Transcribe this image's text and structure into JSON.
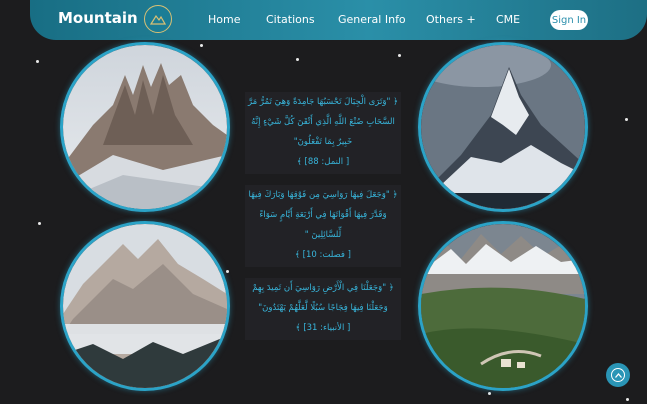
{
  "nav": {
    "brand": "Mountain",
    "links": [
      "Home",
      "Citations",
      "General Info",
      "Others +",
      "CME"
    ],
    "sign_in": "Sign In"
  },
  "verses": [
    {
      "text": "﴿ \"وَتَرَى الْجِبَالَ تَحْسَبُهَا جَامِدَةً وَهِيَ تَمُرُّ مَرَّ السَّحَابِ صُنْعَ اللَّهِ الَّذِي أَتْقَنَ كُلَّ شَيْءٍ إِنَّهُ خَبِيرٌ بِمَا تَفْعَلُونَ\"",
      "ref": "[ النمل: 88] ﴾"
    },
    {
      "text": "﴿ \"وَجَعَلَ فِيهَا رَوَاسِيَ مِن فَوْقِهَا وَبَارَكَ فِيهَا وَقَدَّرَ فِيهَا أَقْوَاتَهَا فِي أَرْبَعَةِ أَيَّامٍ سَوَاءً لِّلسَّائِلِينَ \"",
      "ref": "[ فصلت: 10] ﴾"
    },
    {
      "text": "﴿ \"وَجَعَلْنَا فِي الْأَرْضِ رَوَاسِيَ أَن تَمِيدَ بِهِمْ وَجَعَلْنَا فِيهَا فِجَاجًا سُبُلًا لَّعَلَّهُمْ يَهْتَدُونَ\"",
      "ref": "[ الأنبياء: 31] ﴾"
    }
  ],
  "icons": {
    "logo": "mountain-logo-icon",
    "scroll_top": "chevron-up-icon"
  },
  "colors": {
    "background": "#1c1c1e",
    "nav_gradient_start": "#186e84",
    "nav_gradient_end": "#2a8fa8",
    "accent": "#2ba3c7",
    "verse_text": "#38b6dc"
  }
}
